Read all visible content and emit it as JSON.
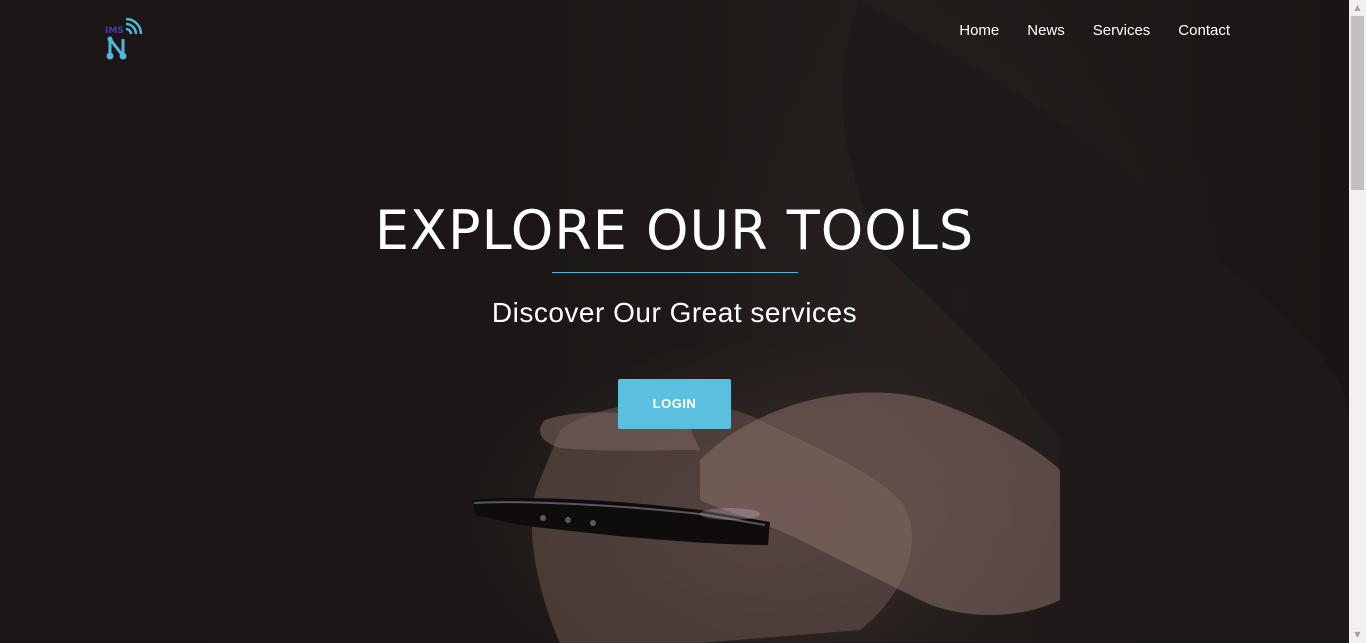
{
  "brand": {
    "logo_text": "IMS",
    "logo_letter": "N",
    "logo_color": "#4fb7d9",
    "logo_text_color": "#3a3fb8"
  },
  "nav": {
    "items": [
      {
        "label": "Home"
      },
      {
        "label": "News"
      },
      {
        "label": "Services"
      },
      {
        "label": "Contact"
      }
    ]
  },
  "hero": {
    "title": "EXPLORE OUR TOOLS",
    "subtitle": "Discover Our Great services",
    "login_label": "LOGIN",
    "accent_color": "#5bbfdf"
  },
  "icons": {
    "logo": "wifi-network-logo-icon",
    "scroll_up": "scroll-up-arrow-icon",
    "scroll_down": "scroll-down-arrow-icon"
  }
}
